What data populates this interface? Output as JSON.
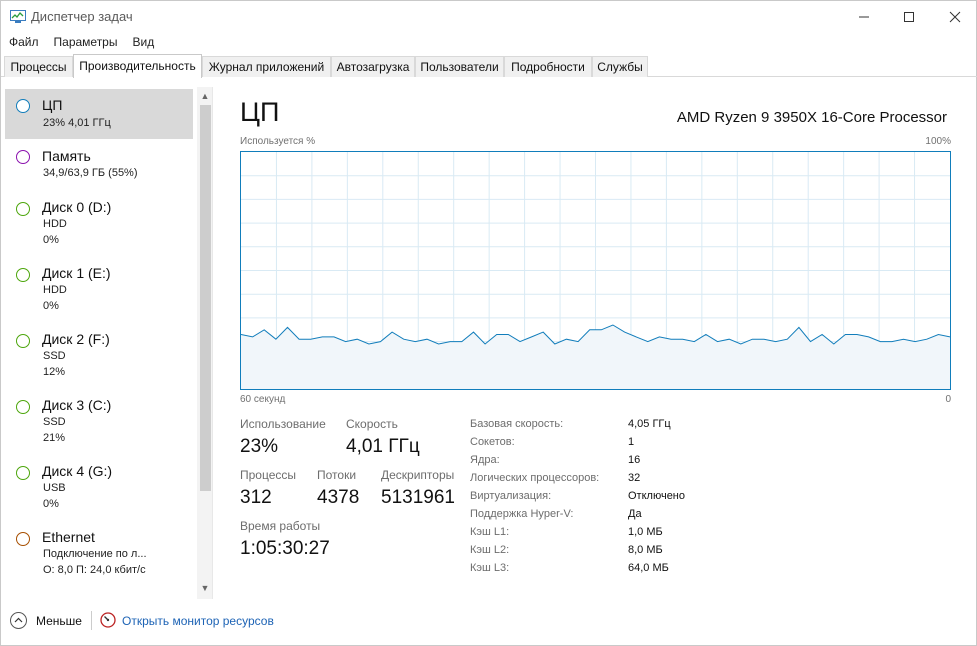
{
  "window": {
    "title": "Диспетчер задач"
  },
  "menu": [
    "Файл",
    "Параметры",
    "Вид"
  ],
  "tabs": [
    "Процессы",
    "Производительность",
    "Журнал приложений",
    "Автозагрузка",
    "Пользователи",
    "Подробности",
    "Службы"
  ],
  "active_tab": "Производительность",
  "sidebar": {
    "items": [
      {
        "title": "ЦП",
        "line1": "23%  4,01 ГГц",
        "line2": "",
        "color": "#117dbb",
        "selected": true
      },
      {
        "title": "Память",
        "line1": "34,9/63,9 ГБ (55%)",
        "line2": "",
        "color": "#8b12ae"
      },
      {
        "title": "Диск 0 (D:)",
        "line1": "HDD",
        "line2": "0%",
        "color": "#4da60c"
      },
      {
        "title": "Диск 1 (E:)",
        "line1": "HDD",
        "line2": "0%",
        "color": "#4da60c"
      },
      {
        "title": "Диск 2 (F:)",
        "line1": "SSD",
        "line2": "12%",
        "color": "#4da60c"
      },
      {
        "title": "Диск 3 (C:)",
        "line1": "SSD",
        "line2": "21%",
        "color": "#4da60c"
      },
      {
        "title": "Диск 4 (G:)",
        "line1": "USB",
        "line2": "0%",
        "color": "#4da60c"
      },
      {
        "title": "Ethernet",
        "line1": "Подключение по л...",
        "line2": "О: 8,0 П: 24,0 кбит/с",
        "color": "#a74f01"
      }
    ]
  },
  "main": {
    "title": "ЦП",
    "cpu_name": "AMD Ryzen 9 3950X 16-Core Processor",
    "graph": {
      "y_label": "Используется %",
      "y_max_label": "100%",
      "x_left_label": "60 секунд",
      "x_right_label": "0",
      "line_color": "#117dbb",
      "fill_color": "#f1f6fa",
      "grid_color": "#d9eaf4",
      "utilization_percent": [
        23,
        22,
        25,
        21,
        26,
        21,
        21,
        22,
        22,
        20,
        21,
        19,
        20,
        24,
        21,
        20,
        21,
        19,
        20,
        20,
        24,
        19,
        23,
        23,
        20,
        22,
        24,
        19,
        21,
        20,
        25,
        25,
        27,
        24,
        22,
        20,
        22,
        21,
        21,
        20,
        23,
        20,
        21,
        19,
        21,
        21,
        20,
        21,
        26,
        20,
        23,
        19,
        23,
        23,
        22,
        20,
        20,
        21,
        20,
        21,
        23,
        22
      ]
    },
    "stats": {
      "utilization_label": "Использование",
      "utilization": "23%",
      "speed_label": "Скорость",
      "speed": "4,01 ГГц",
      "processes_label": "Процессы",
      "processes": "312",
      "threads_label": "Потоки",
      "threads": "4378",
      "handles_label": "Дескрипторы",
      "handles": "5131961",
      "uptime_label": "Время работы",
      "uptime": "1:05:30:27"
    },
    "specs": [
      {
        "label": "Базовая скорость:",
        "value": "4,05 ГГц"
      },
      {
        "label": "Сокетов:",
        "value": "1"
      },
      {
        "label": "Ядра:",
        "value": "16"
      },
      {
        "label": "Логических процессоров:",
        "value": "32"
      },
      {
        "label": "Виртуализация:",
        "value": "Отключено"
      },
      {
        "label": "Поддержка Hyper-V:",
        "value": "Да"
      },
      {
        "label": "Кэш L1:",
        "value": "1,0 МБ"
      },
      {
        "label": "Кэш L2:",
        "value": "8,0 МБ"
      },
      {
        "label": "Кэш L3:",
        "value": "64,0 МБ"
      }
    ]
  },
  "footer": {
    "fewer": "Меньше",
    "resource_monitor": "Открыть монитор ресурсов"
  }
}
